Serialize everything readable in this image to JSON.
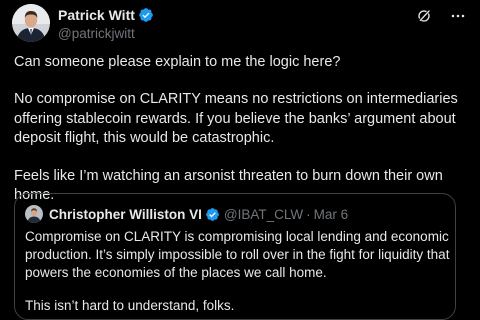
{
  "author": {
    "name": "Patrick Witt",
    "handle": "@patrickjwitt",
    "verified_color": "#1d9bf0"
  },
  "actions": {
    "grok_icon": "grok-icon",
    "more_icon": "more-icon"
  },
  "tweet": {
    "paragraphs": [
      "Can someone please explain to me the logic here?",
      "No compromise on CLARITY means no restrictions on intermediaries offering stablecoin rewards. If you believe the banks’ argument about deposit flight, this would be catastrophic.",
      "Feels like I’m watching an arsonist threaten to burn down their own home."
    ]
  },
  "quote": {
    "name": "Christopher Williston VI",
    "handle": "@IBAT_CLW",
    "separator": "·",
    "date": "Mar 6",
    "paragraphs": [
      "Compromise on CLARITY is compromising local lending and economic production.  It’s simply impossible to roll over in the fight for liquidity that powers the economies of the places we call home.",
      "This isn’t hard to understand, folks."
    ]
  },
  "colors": {
    "background": "#000000",
    "text": "#e7e9ea",
    "secondary": "#71767b",
    "border": "#3e4144",
    "verified": "#1d9bf0"
  }
}
